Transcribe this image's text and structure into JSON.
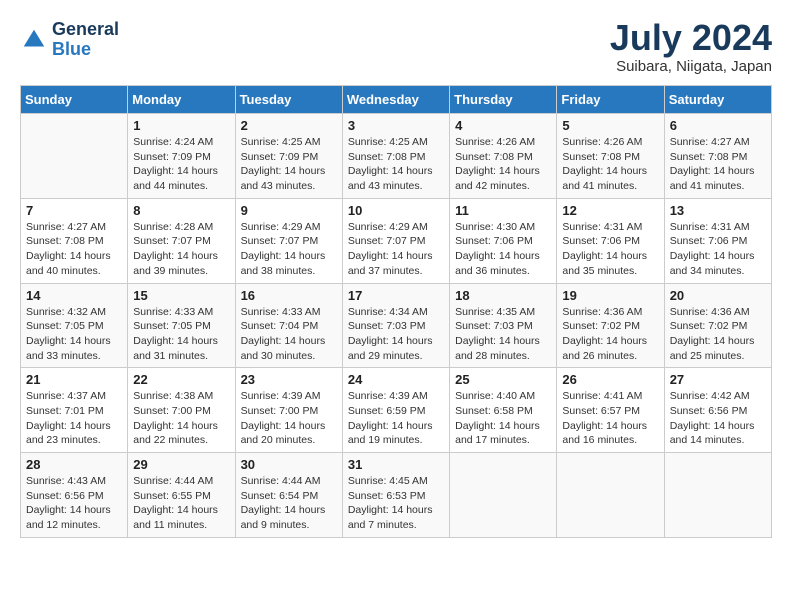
{
  "header": {
    "logo_general": "General",
    "logo_blue": "Blue",
    "month_title": "July 2024",
    "location": "Suibara, Niigata, Japan"
  },
  "days_of_week": [
    "Sunday",
    "Monday",
    "Tuesday",
    "Wednesday",
    "Thursday",
    "Friday",
    "Saturday"
  ],
  "weeks": [
    [
      {
        "day": "",
        "info": ""
      },
      {
        "day": "1",
        "info": "Sunrise: 4:24 AM\nSunset: 7:09 PM\nDaylight: 14 hours\nand 44 minutes."
      },
      {
        "day": "2",
        "info": "Sunrise: 4:25 AM\nSunset: 7:09 PM\nDaylight: 14 hours\nand 43 minutes."
      },
      {
        "day": "3",
        "info": "Sunrise: 4:25 AM\nSunset: 7:08 PM\nDaylight: 14 hours\nand 43 minutes."
      },
      {
        "day": "4",
        "info": "Sunrise: 4:26 AM\nSunset: 7:08 PM\nDaylight: 14 hours\nand 42 minutes."
      },
      {
        "day": "5",
        "info": "Sunrise: 4:26 AM\nSunset: 7:08 PM\nDaylight: 14 hours\nand 41 minutes."
      },
      {
        "day": "6",
        "info": "Sunrise: 4:27 AM\nSunset: 7:08 PM\nDaylight: 14 hours\nand 41 minutes."
      }
    ],
    [
      {
        "day": "7",
        "info": "Sunrise: 4:27 AM\nSunset: 7:08 PM\nDaylight: 14 hours\nand 40 minutes."
      },
      {
        "day": "8",
        "info": "Sunrise: 4:28 AM\nSunset: 7:07 PM\nDaylight: 14 hours\nand 39 minutes."
      },
      {
        "day": "9",
        "info": "Sunrise: 4:29 AM\nSunset: 7:07 PM\nDaylight: 14 hours\nand 38 minutes."
      },
      {
        "day": "10",
        "info": "Sunrise: 4:29 AM\nSunset: 7:07 PM\nDaylight: 14 hours\nand 37 minutes."
      },
      {
        "day": "11",
        "info": "Sunrise: 4:30 AM\nSunset: 7:06 PM\nDaylight: 14 hours\nand 36 minutes."
      },
      {
        "day": "12",
        "info": "Sunrise: 4:31 AM\nSunset: 7:06 PM\nDaylight: 14 hours\nand 35 minutes."
      },
      {
        "day": "13",
        "info": "Sunrise: 4:31 AM\nSunset: 7:06 PM\nDaylight: 14 hours\nand 34 minutes."
      }
    ],
    [
      {
        "day": "14",
        "info": "Sunrise: 4:32 AM\nSunset: 7:05 PM\nDaylight: 14 hours\nand 33 minutes."
      },
      {
        "day": "15",
        "info": "Sunrise: 4:33 AM\nSunset: 7:05 PM\nDaylight: 14 hours\nand 31 minutes."
      },
      {
        "day": "16",
        "info": "Sunrise: 4:33 AM\nSunset: 7:04 PM\nDaylight: 14 hours\nand 30 minutes."
      },
      {
        "day": "17",
        "info": "Sunrise: 4:34 AM\nSunset: 7:03 PM\nDaylight: 14 hours\nand 29 minutes."
      },
      {
        "day": "18",
        "info": "Sunrise: 4:35 AM\nSunset: 7:03 PM\nDaylight: 14 hours\nand 28 minutes."
      },
      {
        "day": "19",
        "info": "Sunrise: 4:36 AM\nSunset: 7:02 PM\nDaylight: 14 hours\nand 26 minutes."
      },
      {
        "day": "20",
        "info": "Sunrise: 4:36 AM\nSunset: 7:02 PM\nDaylight: 14 hours\nand 25 minutes."
      }
    ],
    [
      {
        "day": "21",
        "info": "Sunrise: 4:37 AM\nSunset: 7:01 PM\nDaylight: 14 hours\nand 23 minutes."
      },
      {
        "day": "22",
        "info": "Sunrise: 4:38 AM\nSunset: 7:00 PM\nDaylight: 14 hours\nand 22 minutes."
      },
      {
        "day": "23",
        "info": "Sunrise: 4:39 AM\nSunset: 7:00 PM\nDaylight: 14 hours\nand 20 minutes."
      },
      {
        "day": "24",
        "info": "Sunrise: 4:39 AM\nSunset: 6:59 PM\nDaylight: 14 hours\nand 19 minutes."
      },
      {
        "day": "25",
        "info": "Sunrise: 4:40 AM\nSunset: 6:58 PM\nDaylight: 14 hours\nand 17 minutes."
      },
      {
        "day": "26",
        "info": "Sunrise: 4:41 AM\nSunset: 6:57 PM\nDaylight: 14 hours\nand 16 minutes."
      },
      {
        "day": "27",
        "info": "Sunrise: 4:42 AM\nSunset: 6:56 PM\nDaylight: 14 hours\nand 14 minutes."
      }
    ],
    [
      {
        "day": "28",
        "info": "Sunrise: 4:43 AM\nSunset: 6:56 PM\nDaylight: 14 hours\nand 12 minutes."
      },
      {
        "day": "29",
        "info": "Sunrise: 4:44 AM\nSunset: 6:55 PM\nDaylight: 14 hours\nand 11 minutes."
      },
      {
        "day": "30",
        "info": "Sunrise: 4:44 AM\nSunset: 6:54 PM\nDaylight: 14 hours\nand 9 minutes."
      },
      {
        "day": "31",
        "info": "Sunrise: 4:45 AM\nSunset: 6:53 PM\nDaylight: 14 hours\nand 7 minutes."
      },
      {
        "day": "",
        "info": ""
      },
      {
        "day": "",
        "info": ""
      },
      {
        "day": "",
        "info": ""
      }
    ]
  ]
}
